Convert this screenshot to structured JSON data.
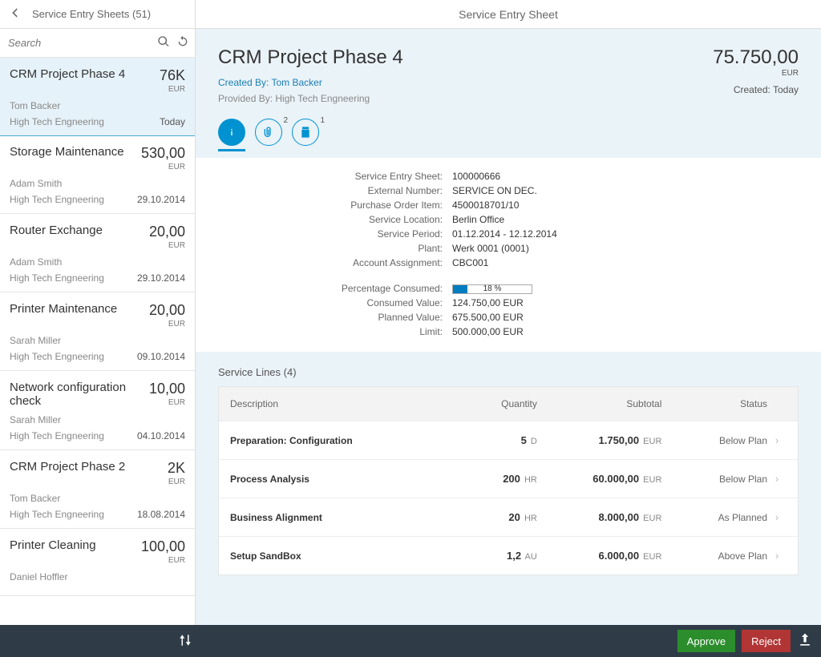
{
  "header": {
    "list_title": "Service Entry Sheets (51)",
    "detail_title": "Service Entry Sheet"
  },
  "search": {
    "placeholder": "Search"
  },
  "currency": "EUR",
  "list": [
    {
      "title": "CRM Project Phase 4",
      "amount": "76K",
      "person": "Tom Backer",
      "company": "High Tech Engneering",
      "date": "Today",
      "selected": true
    },
    {
      "title": "Storage Maintenance",
      "amount": "530,00",
      "person": "Adam Smith",
      "company": "High Tech Engneering",
      "date": "29.10.2014"
    },
    {
      "title": "Router Exchange",
      "amount": "20,00",
      "person": "Adam Smith",
      "company": "High Tech Engneering",
      "date": "29.10.2014"
    },
    {
      "title": "Printer Maintenance",
      "amount": "20,00",
      "person": "Sarah Miller",
      "company": "High Tech Engneering",
      "date": "09.10.2014"
    },
    {
      "title": "Network configuration check",
      "amount": "10,00",
      "person": "Sarah Miller",
      "company": "High Tech Engneering",
      "date": "04.10.2014"
    },
    {
      "title": "CRM Project Phase 2",
      "amount": "2K",
      "person": "Tom Backer",
      "company": "High Tech Engneering",
      "date": "18.08.2014"
    },
    {
      "title": "Printer Cleaning",
      "amount": "100,00",
      "person": "Daniel Hoffler",
      "company": "",
      "date": ""
    }
  ],
  "detail": {
    "title": "CRM Project Phase 4",
    "amount": "75.750,00",
    "currency": "EUR",
    "created_by_label": "Created By: Tom Backer",
    "provided_by_label": "Provided By: High Tech Engneering",
    "created_label": "Created: Today",
    "tabs": {
      "attach_count": "2",
      "notes_count": "1"
    },
    "info": {
      "labels": {
        "sheet": "Service Entry Sheet:",
        "ext": "External Number:",
        "po": "Purchase Order Item:",
        "loc": "Service Location:",
        "period": "Service Period:",
        "plant": "Plant:",
        "acct": "Account Assignment:",
        "pct": "Percentage Consumed:",
        "consumed": "Consumed Value:",
        "planned": "Planned Value:",
        "limit": "Limit:"
      },
      "values": {
        "sheet": "100000666",
        "ext": "SERVICE ON DEC.",
        "po": "4500018701/10",
        "loc": "Berlin Office",
        "period": "01.12.2014 - 12.12.2014",
        "plant": "Werk 0001 (0001)",
        "acct": "CBC001",
        "pct_text": "18 %",
        "pct_fill": 18,
        "consumed": "124.750,00 EUR",
        "planned": "675.500,00 EUR",
        "limit": "500.000,00 EUR"
      }
    },
    "service_lines": {
      "title": "Service Lines (4)",
      "headers": {
        "desc": "Description",
        "qty": "Quantity",
        "sub": "Subtotal",
        "status": "Status"
      },
      "rows": [
        {
          "desc": "Preparation: Configuration",
          "qty": "5",
          "unit": "D",
          "sub": "1.750,00",
          "cur": "EUR",
          "status": "Below Plan"
        },
        {
          "desc": "Process Analysis",
          "qty": "200",
          "unit": "HR",
          "sub": "60.000,00",
          "cur": "EUR",
          "status": "Below Plan"
        },
        {
          "desc": "Business Alignment",
          "qty": "20",
          "unit": "HR",
          "sub": "8.000,00",
          "cur": "EUR",
          "status": "As Planned"
        },
        {
          "desc": "Setup SandBox",
          "qty": "1,2",
          "unit": "AU",
          "sub": "6.000,00",
          "cur": "EUR",
          "status": "Above Plan"
        }
      ]
    }
  },
  "footer": {
    "approve": "Approve",
    "reject": "Reject"
  }
}
